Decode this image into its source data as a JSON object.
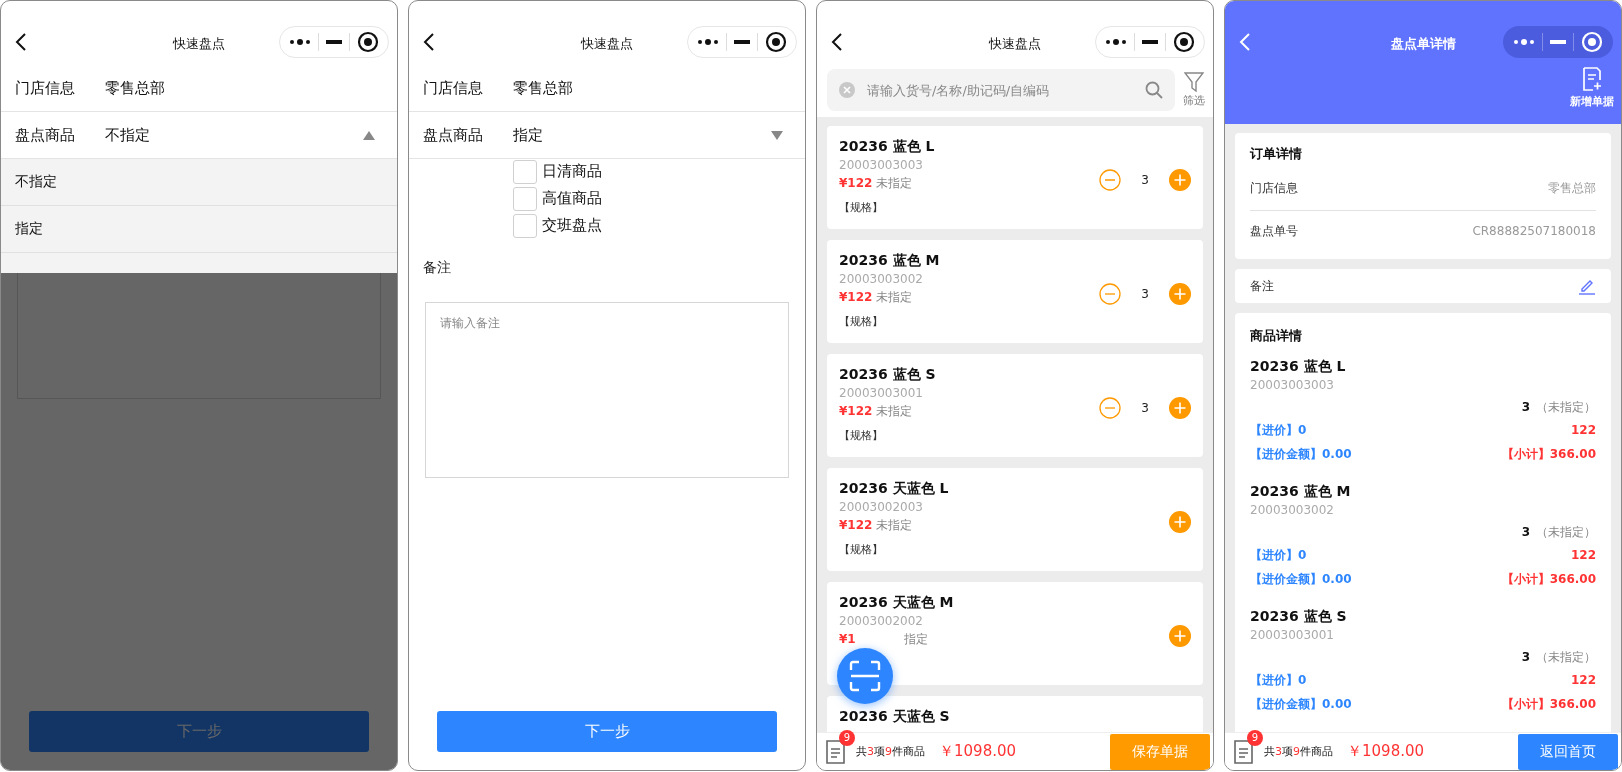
{
  "screens": [
    {
      "kind": "form",
      "title": "快速盘点",
      "fields": [
        {
          "label": "门店信息",
          "value": "零售总部"
        },
        {
          "label": "盘点商品",
          "value": "不指定",
          "expanded": true
        }
      ],
      "dropdown_options": [
        {
          "label": "不指定"
        },
        {
          "label": "指定"
        }
      ],
      "overlay": true,
      "button": "下一步"
    },
    {
      "kind": "form",
      "title": "快速盘点",
      "fields": [
        {
          "label": "门店信息",
          "value": "零售总部"
        },
        {
          "label": "盘点商品",
          "value": "指定",
          "expanded": false
        }
      ],
      "checkboxes": [
        {
          "label": "日清商品",
          "checked": false
        },
        {
          "label": "高值商品",
          "checked": false
        },
        {
          "label": "交班盘点",
          "checked": false
        }
      ],
      "remark_label": "备注",
      "remark_placeholder": "请输入备注",
      "overlay": false,
      "button": "下一步"
    },
    {
      "kind": "list",
      "title": "快速盘点",
      "search_placeholder": "请输入货号/名称/助记码/自编码",
      "filter_label": "筛选",
      "items": [
        {
          "name": "20236 蓝色 L",
          "code": "20003003003",
          "price": "¥122",
          "status": "未指定",
          "spec": "【规格】",
          "quantity": "3"
        },
        {
          "name": "20236 蓝色 M",
          "code": "20003003002",
          "price": "¥122",
          "status": "未指定",
          "spec": "【规格】",
          "quantity": "3"
        },
        {
          "name": "20236 蓝色 S",
          "code": "20003003001",
          "price": "¥122",
          "status": "未指定",
          "spec": "【规格】",
          "quantity": "3"
        },
        {
          "name": "20236 天蓝色 L",
          "code": "20003002003",
          "price": "¥122",
          "status": "未指定",
          "spec": "【规格】"
        },
        {
          "name": "20236 天蓝色 M",
          "code": "20003002002",
          "price": "¥1",
          "status": "指定"
        },
        {
          "name": "20236 天蓝色 S"
        }
      ],
      "footer": {
        "badge": "9",
        "summary": [
          {
            "text": "共",
            "accent": false
          },
          {
            "text": "3",
            "accent": true
          },
          {
            "text": "项",
            "accent": false
          },
          {
            "text": "9",
            "accent": true
          },
          {
            "text": "件商品",
            "accent": false
          }
        ],
        "total": "￥1098.00",
        "button": "保存单据"
      }
    },
    {
      "kind": "detail",
      "title": "盘点单详情",
      "action": "新增单据",
      "order": {
        "heading": "订单详情",
        "rows": [
          {
            "label": "门店信息",
            "value": "零售总部"
          },
          {
            "label": "盘点单号",
            "value": "CR88882507180018"
          }
        ]
      },
      "remark_label": "备注",
      "products": {
        "heading": "商品详情",
        "items": [
          {
            "name": "20236 蓝色 L",
            "code": "20003003003",
            "quantity": "3",
            "status": "（未指定）",
            "cost": "【进价】0",
            "price": "122",
            "cost_total": "【进价金额】0.00",
            "subtotal": "【小计】366.00"
          },
          {
            "name": "20236 蓝色 M",
            "code": "20003003002",
            "quantity": "3",
            "status": "（未指定）",
            "cost": "【进价】0",
            "price": "122",
            "cost_total": "【进价金额】0.00",
            "subtotal": "【小计】366.00"
          },
          {
            "name": "20236 蓝色 S",
            "code": "20003003001",
            "quantity": "3",
            "status": "（未指定）",
            "cost": "【进价】0",
            "price": "122",
            "cost_total": "【进价金额】0.00",
            "subtotal": "【小计】366.00"
          }
        ]
      },
      "footer": {
        "badge": "9",
        "summary": [
          {
            "text": "共",
            "accent": false
          },
          {
            "text": "3",
            "accent": true
          },
          {
            "text": "项",
            "accent": false
          },
          {
            "text": "9",
            "accent": true
          },
          {
            "text": "件商品",
            "accent": false
          }
        ],
        "total": "￥1098.00",
        "button": "返回首页"
      }
    }
  ]
}
